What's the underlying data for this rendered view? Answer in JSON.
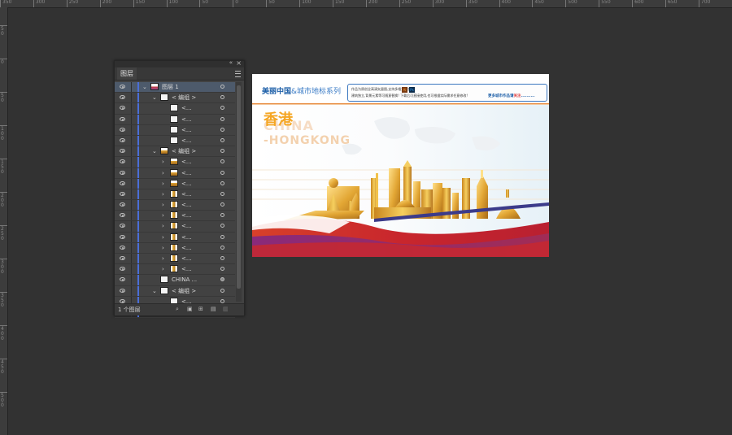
{
  "ruler": {
    "top_labels": [
      "350",
      "300",
      "250",
      "200",
      "150",
      "100",
      "50",
      "0",
      "50",
      "100",
      "150",
      "200",
      "250",
      "300",
      "350",
      "400",
      "450",
      "500",
      "550",
      "600",
      "650",
      "700"
    ],
    "left_labels": [
      "50",
      "0",
      "50",
      "100",
      "150",
      "200",
      "250",
      "300",
      "350",
      "400",
      "450",
      "500"
    ]
  },
  "layers_panel": {
    "tab_title": "图层",
    "footer_count": "1 个图层",
    "rows": [
      {
        "label": "图层 1",
        "level": 0,
        "expanded": true,
        "thumb": "layer"
      },
      {
        "label": "< 编组 >",
        "level": 1,
        "expanded": true,
        "thumb": "white"
      },
      {
        "label": "<...",
        "level": 2,
        "thumb": "white"
      },
      {
        "label": "<...",
        "level": 2,
        "thumb": "white"
      },
      {
        "label": "<...",
        "level": 2,
        "thumb": "white"
      },
      {
        "label": "<...",
        "level": 2,
        "thumb": "white"
      },
      {
        "label": "< 编组 >",
        "level": 1,
        "expanded": true,
        "thumb": "gold"
      },
      {
        "label": "<...",
        "level": 2,
        "collapsed": true,
        "thumb": "gold"
      },
      {
        "label": "<...",
        "level": 2,
        "collapsed": true,
        "thumb": "gold"
      },
      {
        "label": "<...",
        "level": 2,
        "collapsed": true,
        "thumb": "gold"
      },
      {
        "label": "<...",
        "level": 2,
        "collapsed": true,
        "thumb": "goldtall"
      },
      {
        "label": "<...",
        "level": 2,
        "collapsed": true,
        "thumb": "goldtall"
      },
      {
        "label": "<...",
        "level": 2,
        "collapsed": true,
        "thumb": "goldtall"
      },
      {
        "label": "<...",
        "level": 2,
        "collapsed": true,
        "thumb": "goldtall"
      },
      {
        "label": "<...",
        "level": 2,
        "collapsed": true,
        "thumb": "goldtall"
      },
      {
        "label": "<...",
        "level": 2,
        "collapsed": true,
        "thumb": "goldtall"
      },
      {
        "label": "<...",
        "level": 2,
        "collapsed": true,
        "thumb": "goldtall"
      },
      {
        "label": "<...",
        "level": 2,
        "collapsed": true,
        "thumb": "goldtall"
      },
      {
        "label": "CHINA  ...",
        "level": 1,
        "thumb": "white",
        "target_filled": true
      },
      {
        "label": "< 编组 >",
        "level": 1,
        "expanded": true,
        "thumb": "white"
      },
      {
        "label": "<...",
        "level": 2,
        "thumb": "white"
      },
      {
        "label": "更多...",
        "level": 1,
        "thumb": "white"
      }
    ]
  },
  "artboard": {
    "header_title_bold": "美丽中国",
    "header_title_rest": "&城市地标系列",
    "info_line1": "作品为原创全高清矢量图,支持多格式转换",
    "info_line2": "建筑独立,背景元素等可随意替换! 下载后可直接使用,也可根据实际需求任意修改!",
    "info_more": "更多城市作品请",
    "info_follow": "关注",
    "badge_ai": "Ai",
    "badge_ps": "Ps",
    "city_cn": "香港",
    "city_en1": "CHINA",
    "city_en2": "-HONGKONG"
  },
  "colors": {
    "selection_blue": "#4a6ed8",
    "title_blue": "#1d5fa8",
    "city_orange": "#f5a623",
    "red_wave": "#c8262d",
    "purple_wave": "#7b2d7e",
    "gold": "#e2a634"
  }
}
